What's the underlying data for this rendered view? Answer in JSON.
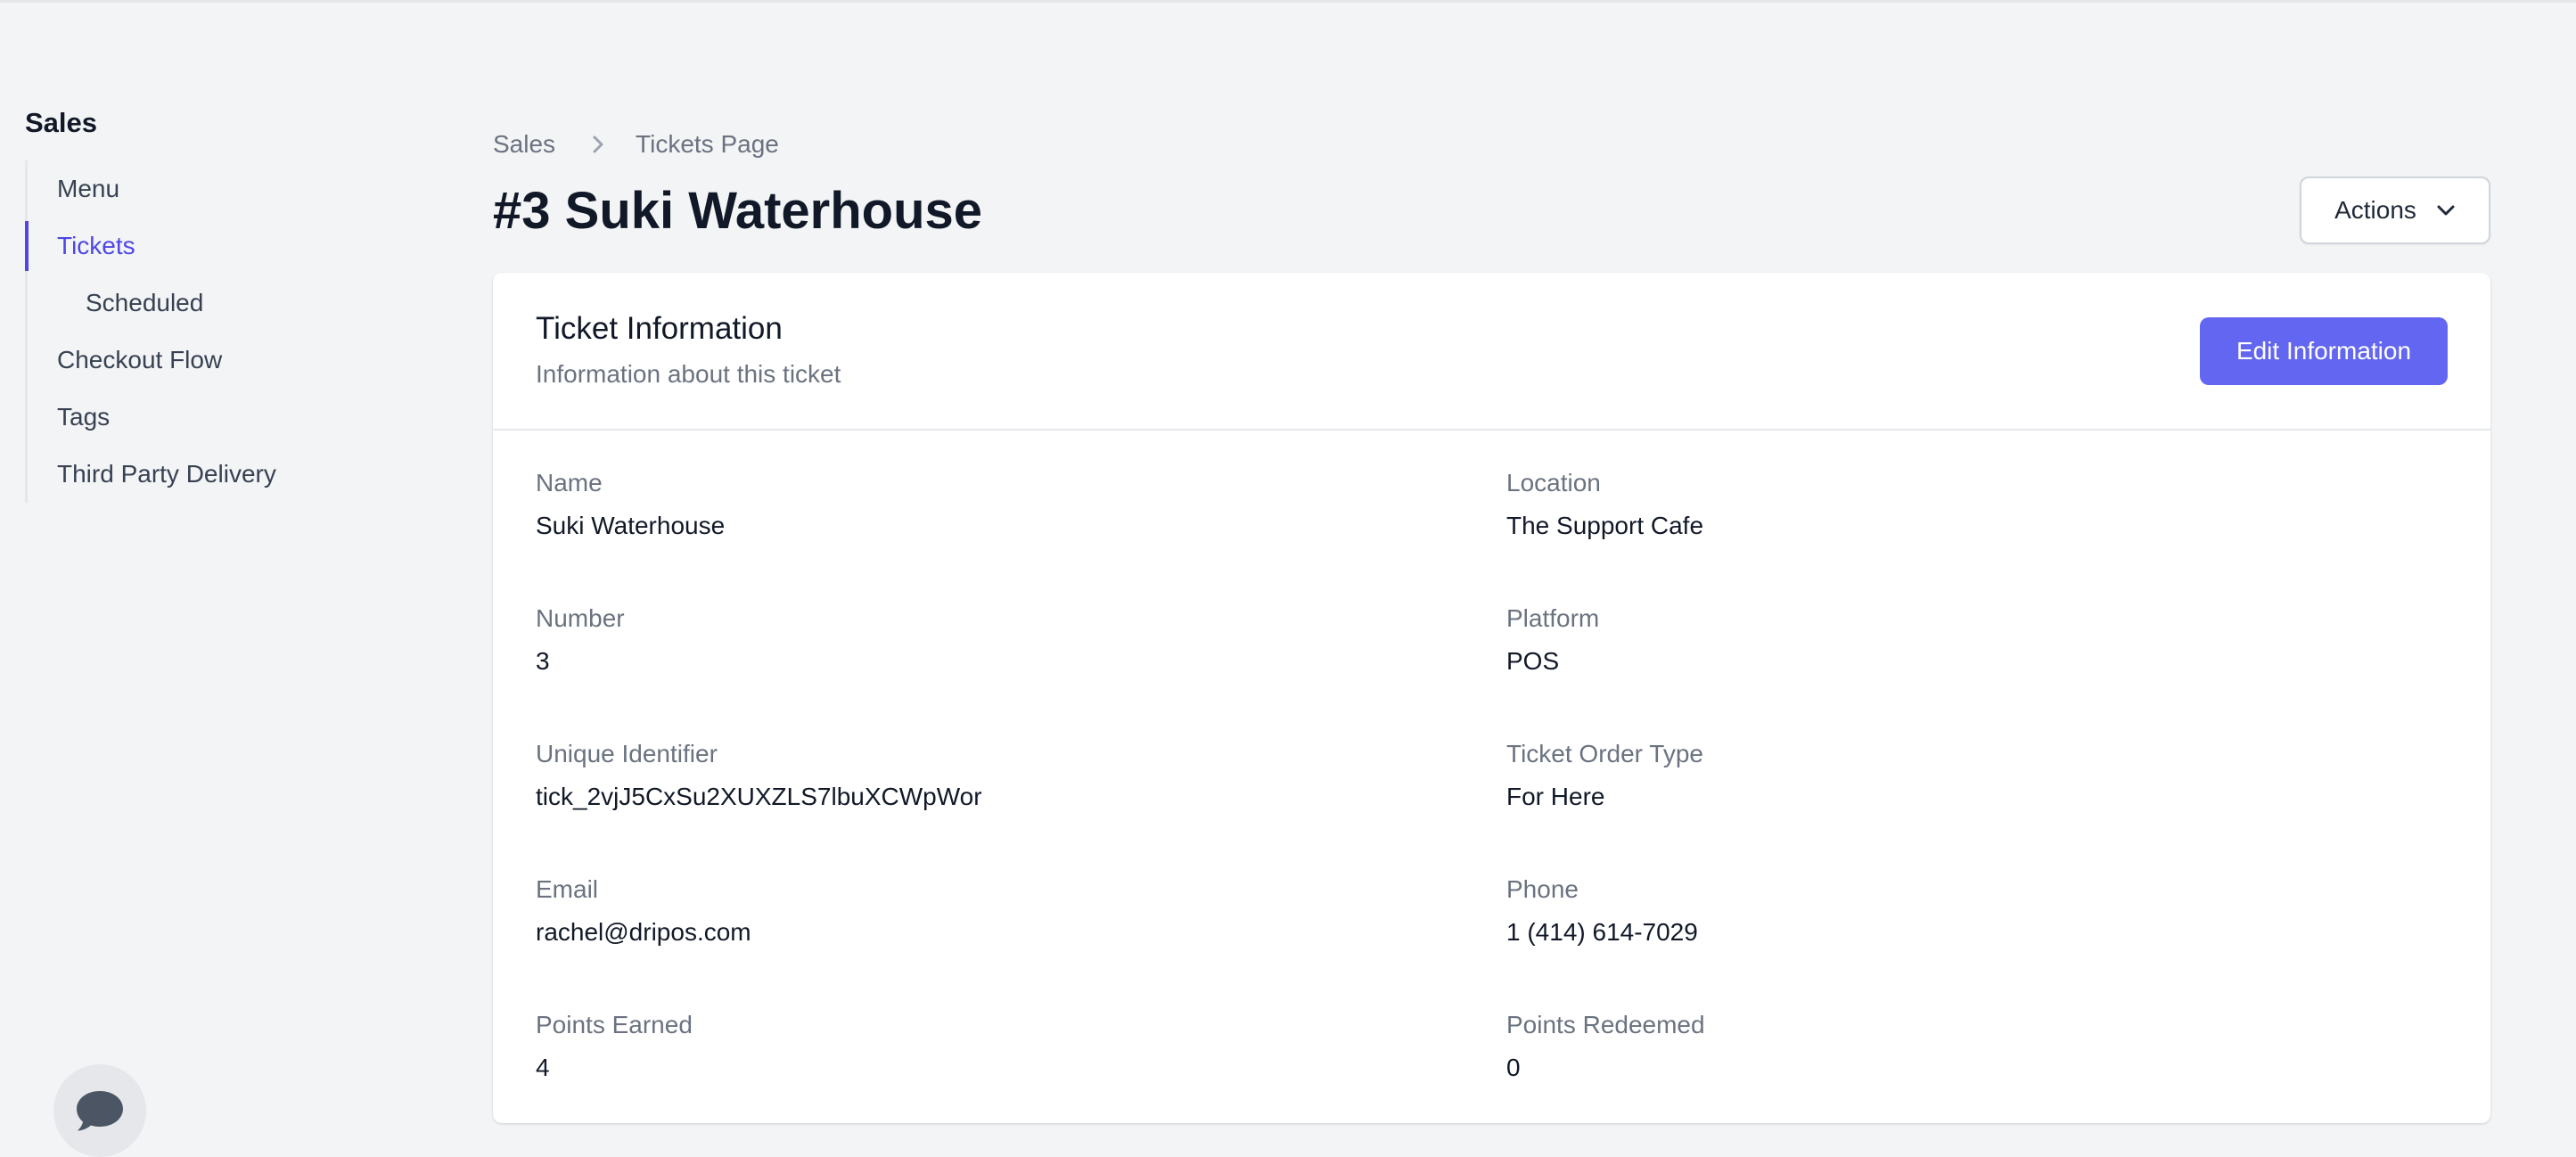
{
  "sidebar": {
    "title": "Sales",
    "items": [
      {
        "label": "Menu"
      },
      {
        "label": "Tickets"
      },
      {
        "label": "Scheduled"
      },
      {
        "label": "Checkout Flow"
      },
      {
        "label": "Tags"
      },
      {
        "label": "Third Party Delivery"
      }
    ]
  },
  "breadcrumb": {
    "items": [
      "Sales",
      "Tickets Page"
    ]
  },
  "page": {
    "title": "#3 Suki Waterhouse",
    "actions_label": "Actions"
  },
  "card": {
    "title": "Ticket Information",
    "subtitle": "Information about this ticket",
    "edit_label": "Edit Information",
    "fields": [
      {
        "label": "Name",
        "value": "Suki Waterhouse"
      },
      {
        "label": "Location",
        "value": "The Support Cafe"
      },
      {
        "label": "Number",
        "value": "3"
      },
      {
        "label": "Platform",
        "value": "POS"
      },
      {
        "label": "Unique Identifier",
        "value": "tick_2vjJ5CxSu2XUXZLS7lbuXCWpWor"
      },
      {
        "label": "Ticket Order Type",
        "value": "For Here"
      },
      {
        "label": "Email",
        "value": "rachel@dripos.com"
      },
      {
        "label": "Phone",
        "value": "1 (414) 614-7029"
      },
      {
        "label": "Points Earned",
        "value": "4"
      },
      {
        "label": "Points Redeemed",
        "value": "0"
      }
    ]
  },
  "colors": {
    "accent": "#6366f1",
    "active_nav": "#4f46e5",
    "background": "#f3f4f6"
  },
  "icons": {
    "breadcrumb_separator": "chevron-right-icon",
    "actions_dropdown": "chevron-down-icon",
    "chat": "chat-bubble-icon"
  }
}
